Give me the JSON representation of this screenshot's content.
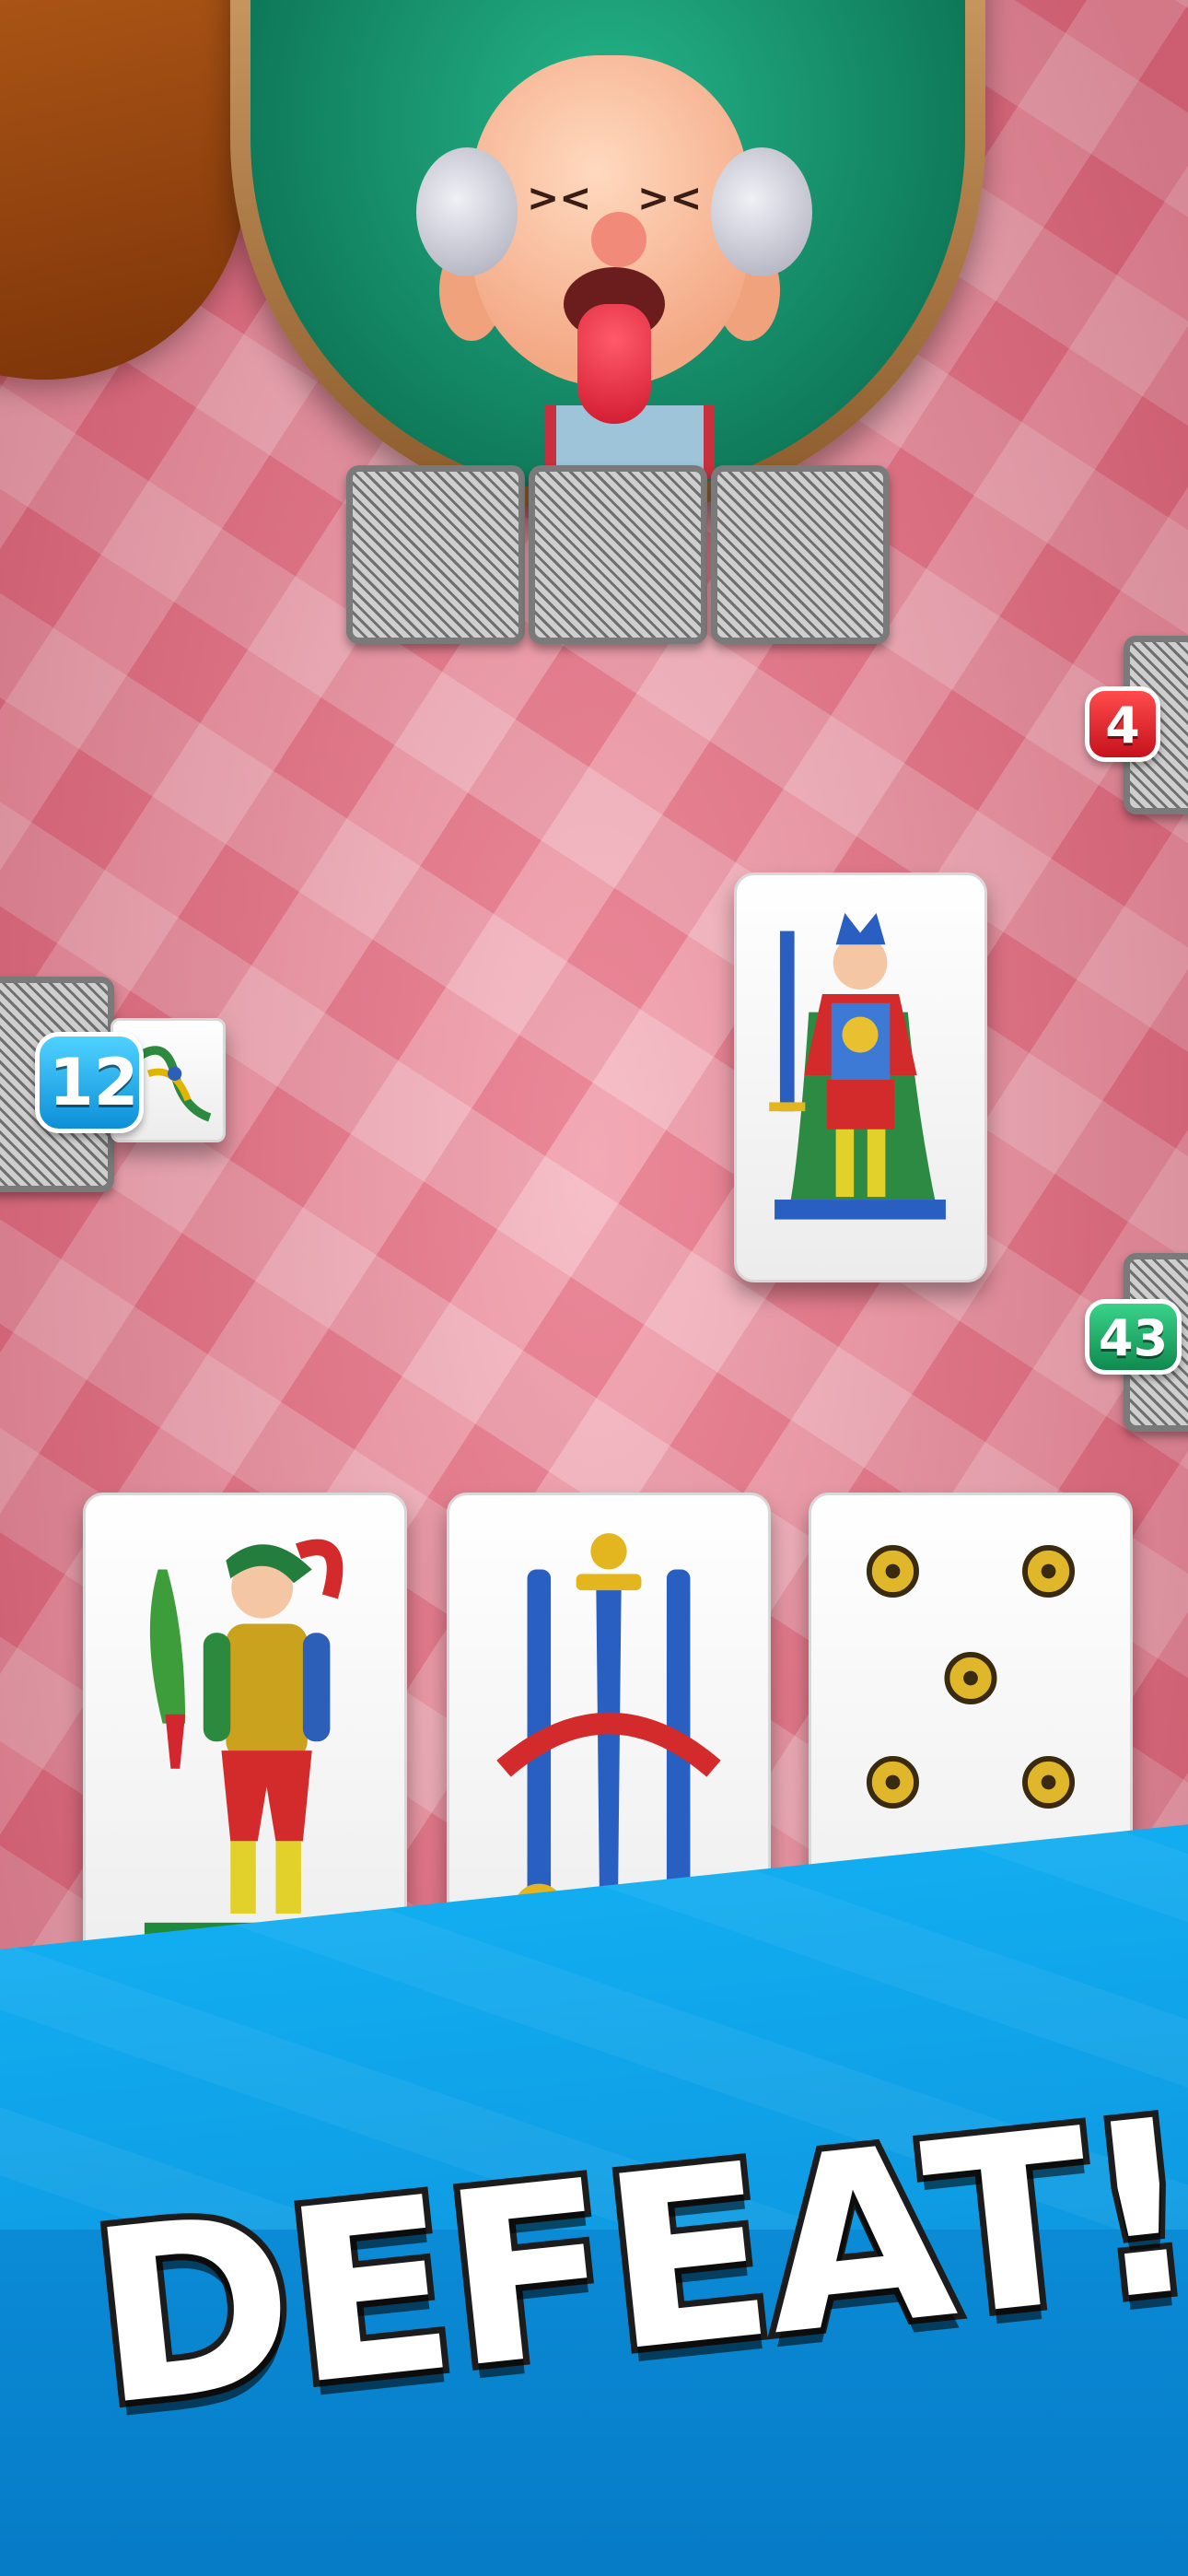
{
  "counters": {
    "right_top": "4",
    "left": "12",
    "right_bottom": "43"
  },
  "banner": {
    "text": "DEFEAT!"
  },
  "colors": {
    "tablecloth_red": "#e74a63",
    "felt_green": "#11956b",
    "banner_blue": "#0a94e0",
    "counter_red": "#d81e28",
    "counter_blue": "#1aa6ec",
    "counter_green": "#16a05c"
  },
  "opponent": {
    "hand_card_backs": 3
  },
  "played_cards": [
    {
      "name": "king of swords"
    },
    {
      "name": "jack of clubs (partially hidden)"
    }
  ],
  "player_hand": [
    {
      "name": "knave of clubs"
    },
    {
      "name": "three of swords"
    },
    {
      "name": "seven of coins"
    }
  ]
}
